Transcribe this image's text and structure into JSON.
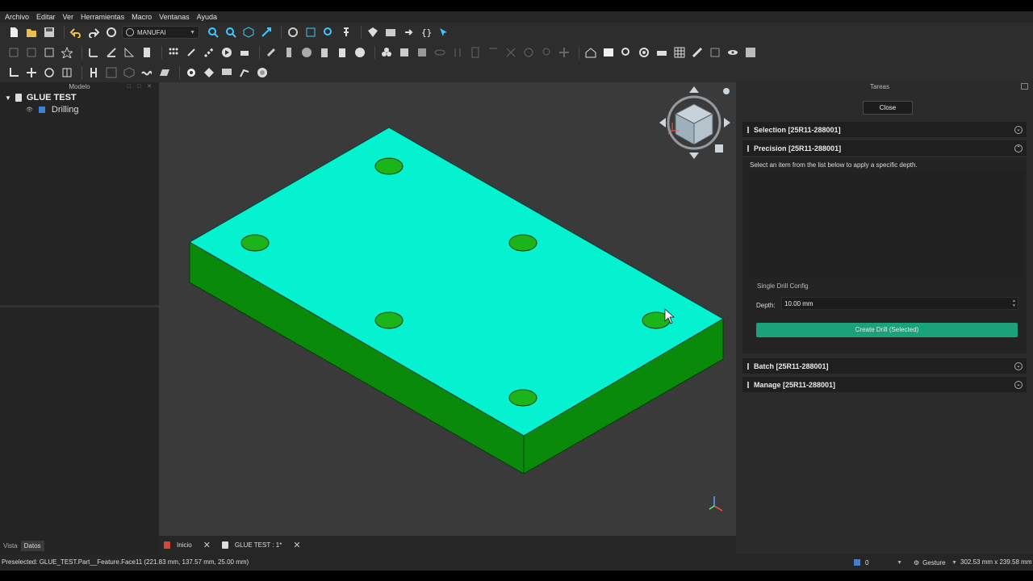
{
  "menu": [
    "Archivo",
    "Editar",
    "Ver",
    "Herramientas",
    "Macro",
    "Ventanas",
    "Ayuda"
  ],
  "toolbar": {
    "workbench": "MANUFAI"
  },
  "model_panel": {
    "title": "Modelo",
    "root": "GLUE TEST",
    "child": "Drilling",
    "tabs": [
      "Vista",
      "Datos"
    ]
  },
  "doc_tabs": [
    "Inicio",
    "GLUE TEST : 1*"
  ],
  "tasks": {
    "title": "Tareas",
    "close": "Close",
    "sections": {
      "selection": "Selection [25R11-288001]",
      "precision": "Precision [25R11-288001]",
      "batch": "Batch [25R11-288001]",
      "manage": "Manage [25R11-288001]"
    },
    "description": "Select an item from the list below to apply a specific depth.",
    "config_title": "Single Drill Config",
    "depth_label": "Depth:",
    "depth_value": "10.00 mm",
    "create_button": "Create Drill (Selected)"
  },
  "status": {
    "text": "Preselected: GLUE_TEST.Part__Feature.Face11 (221.83 mm, 137.57 mm, 25.00 mm)",
    "layer": "0",
    "navigation": "Gesture",
    "dims": "302.53 mm x 239.58 mm"
  },
  "colors": {
    "top_face": "#05f2d1",
    "side_face": "#0a8a0a",
    "hole": "#1bb51b",
    "button_accent": "#1aa27b"
  }
}
